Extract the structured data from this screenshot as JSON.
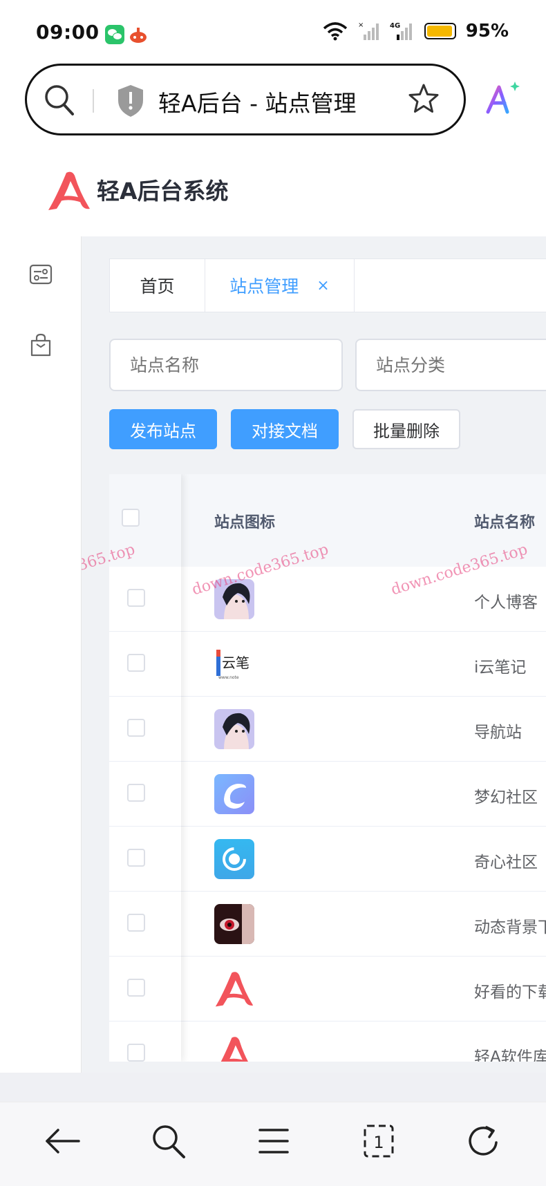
{
  "status_bar": {
    "time": "09:00",
    "battery": "95%",
    "battery_level": 0.95,
    "network_label": "4G"
  },
  "browser": {
    "page_title": "轻A后台 - 站点管理"
  },
  "app": {
    "title": "轻A后台系统"
  },
  "tabs": [
    {
      "label": "首页"
    },
    {
      "label": "站点管理",
      "close": "×"
    }
  ],
  "filters": {
    "site_name_placeholder": "站点名称",
    "site_category_placeholder": "站点分类"
  },
  "actions": {
    "publish": "发布站点",
    "docs": "对接文档",
    "batch_delete": "批量删除"
  },
  "table": {
    "columns": [
      "站点图标",
      "站点名称"
    ],
    "rows": [
      {
        "name": "个人博客",
        "icon": "anime-avatar-icon"
      },
      {
        "name": "i云笔记",
        "icon": "cloud-notes-icon"
      },
      {
        "name": "导航站",
        "icon": "anime-avatar-icon"
      },
      {
        "name": "梦幻社区",
        "icon": "dream-community-icon"
      },
      {
        "name": "奇心社区",
        "icon": "qixin-community-icon"
      },
      {
        "name": "动态背景下",
        "icon": "red-eye-icon"
      },
      {
        "name": "好看的下载",
        "icon": "qinga-logo-icon"
      },
      {
        "name": "轻A软件库",
        "icon": "qinga-logo-icon"
      }
    ]
  },
  "watermark": "down.code365.top",
  "colors": {
    "primary": "#409eff",
    "logo_red": "#f2545b",
    "content_bg": "#f0f2f5"
  }
}
